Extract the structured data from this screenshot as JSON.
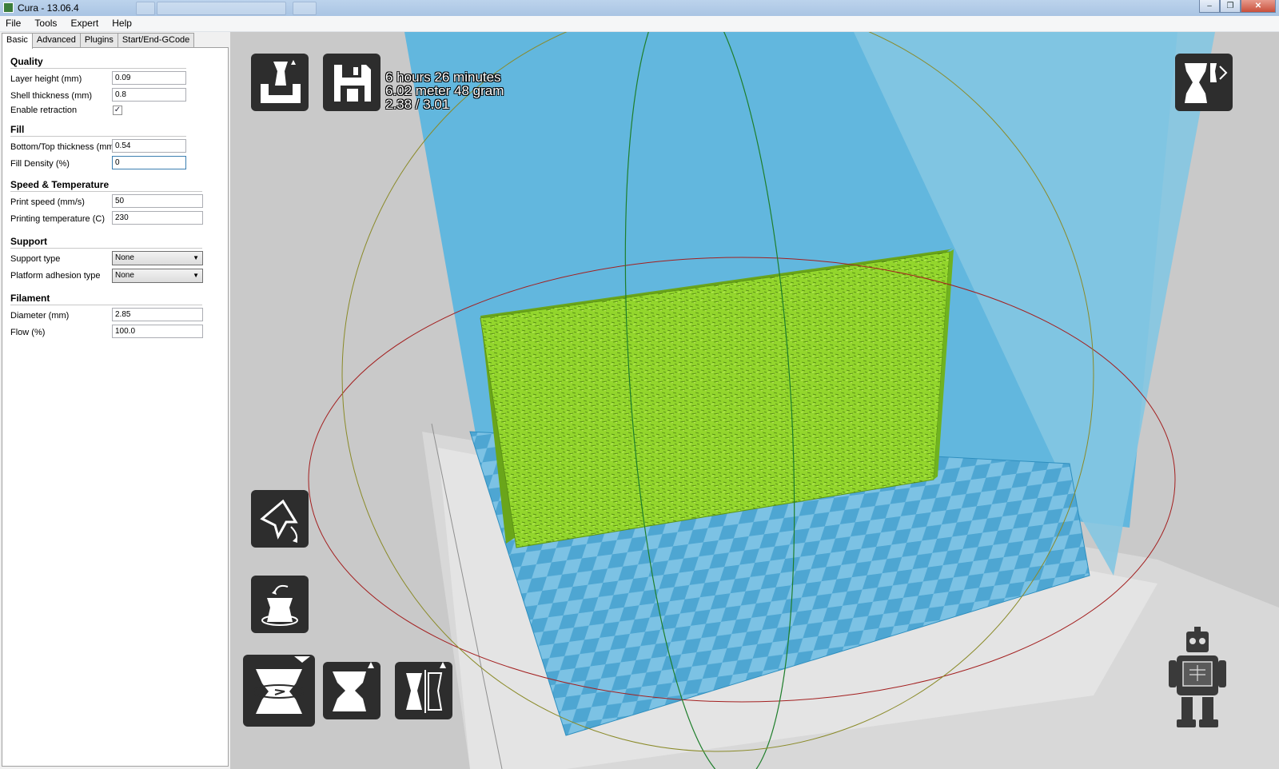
{
  "window": {
    "title": "Cura - 13.06.4",
    "minimize": "–",
    "maximize": "❐",
    "close": "✕"
  },
  "menu": [
    "File",
    "Tools",
    "Expert",
    "Help"
  ],
  "tabs": [
    "Basic",
    "Advanced",
    "Plugins",
    "Start/End-GCode"
  ],
  "sections": {
    "quality": {
      "title": "Quality",
      "layer_height": {
        "label": "Layer height (mm)",
        "value": "0.09"
      },
      "shell_thickness": {
        "label": "Shell thickness (mm)",
        "value": "0.8"
      },
      "retraction": {
        "label": "Enable retraction",
        "checked": true,
        "mark": "✓"
      }
    },
    "fill": {
      "title": "Fill",
      "bottom_top": {
        "label": "Bottom/Top thickness (mm)",
        "value": "0.54"
      },
      "density": {
        "label": "Fill Density (%)",
        "value": "0"
      }
    },
    "speed": {
      "title": "Speed & Temperature",
      "print_speed": {
        "label": "Print speed (mm/s)",
        "value": "50"
      },
      "temperature": {
        "label": "Printing temperature (C)",
        "value": "230"
      }
    },
    "support": {
      "title": "Support",
      "support_type": {
        "label": "Support type",
        "value": "None"
      },
      "adhesion": {
        "label": "Platform adhesion type",
        "value": "None"
      }
    },
    "filament": {
      "title": "Filament",
      "diameter": {
        "label": "Diameter (mm)",
        "value": "2.85"
      },
      "flow": {
        "label": "Flow (%)",
        "value": "100.0"
      }
    }
  },
  "print_stats": [
    "6 hours 26 minutes",
    "6.02 meter 48 gram",
    "2.38 / 3.01"
  ],
  "colors": {
    "build_volume": "#5fb6dc",
    "model": "#8ed42a",
    "platform_checker": "#5aaed6",
    "background": "#c9c9c9"
  },
  "icons": [
    "load-model-icon",
    "save-gcode-icon",
    "view-mode-icon",
    "rotate-icon",
    "rotate-around-icon",
    "scale-icon",
    "mirror-icon",
    "mirror-alt-icon",
    "robot-mascot-icon"
  ]
}
